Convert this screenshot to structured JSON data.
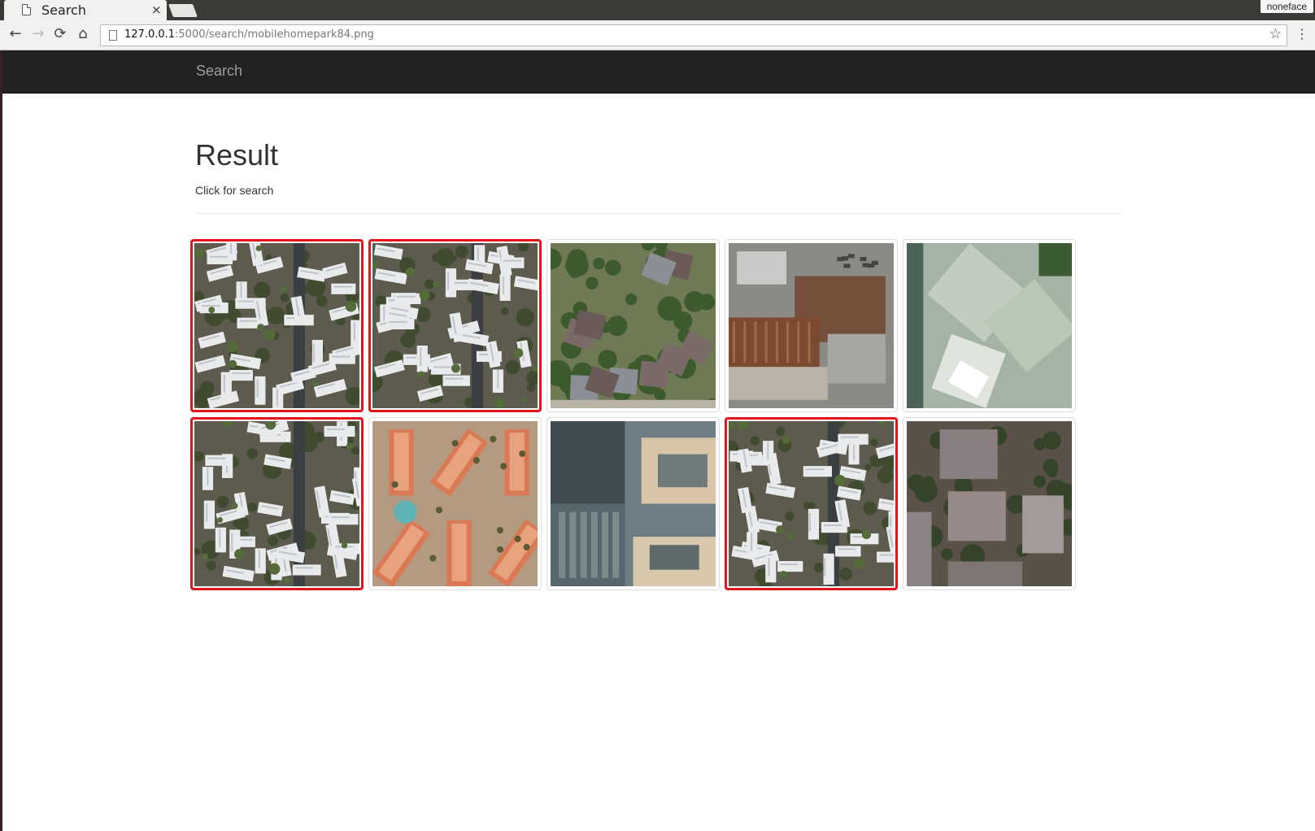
{
  "browser": {
    "tab_title": "Search",
    "tab_close": "×",
    "profile_name": "noneface",
    "url_host": "127.0.0.1",
    "url_path": ":5000/search/mobilehomepark84.png"
  },
  "navbar": {
    "brand": "Search"
  },
  "main": {
    "title": "Result",
    "subtitle": "Click for search"
  },
  "results": [
    {
      "scene": "mobile-home-park",
      "selected": true
    },
    {
      "scene": "mobile-home-park",
      "selected": true
    },
    {
      "scene": "residential",
      "selected": false
    },
    {
      "scene": "industrial",
      "selected": false
    },
    {
      "scene": "large-building",
      "selected": false
    },
    {
      "scene": "mobile-home-park",
      "selected": true
    },
    {
      "scene": "apartments-pool",
      "selected": false
    },
    {
      "scene": "tall-buildings",
      "selected": false
    },
    {
      "scene": "mobile-home-park",
      "selected": true
    },
    {
      "scene": "flat-roof-residential",
      "selected": false
    }
  ],
  "colors": {
    "selected_border": "#e5141b",
    "navbar_bg": "#222222"
  }
}
